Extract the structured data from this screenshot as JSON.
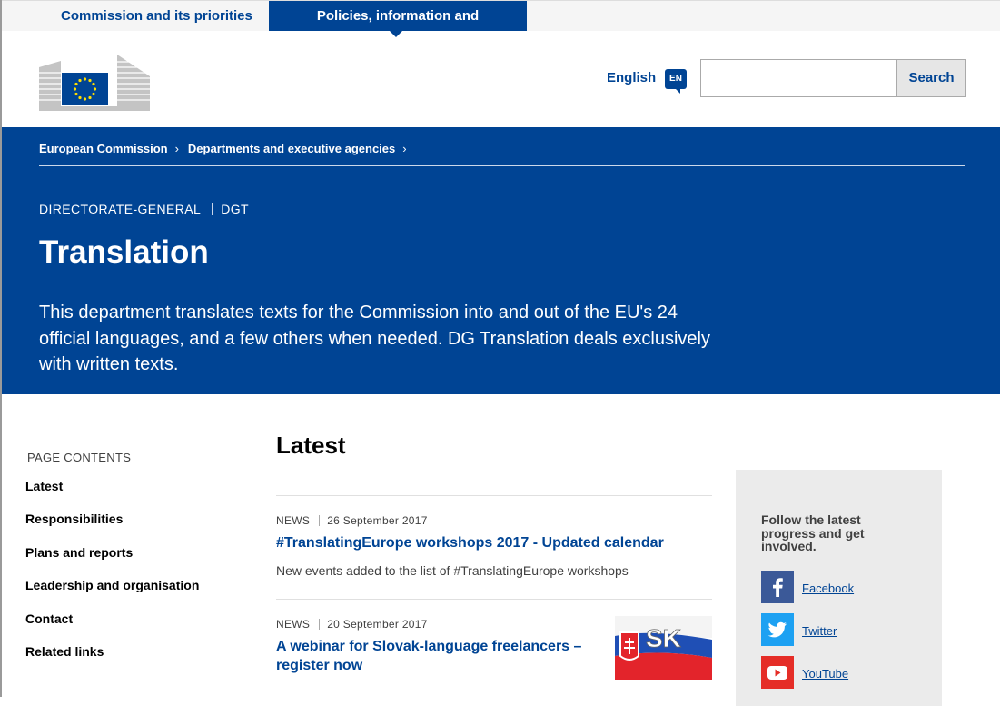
{
  "topnav": {
    "tab1": "Commission and its priorities",
    "tab2": "Policies, information and services"
  },
  "header": {
    "language": "English",
    "language_code": "EN",
    "search_button": "Search",
    "search_placeholder": ""
  },
  "breadcrumb": [
    "European Commission",
    "Departments and executive agencies"
  ],
  "banner": {
    "meta_type": "DIRECTORATE-GENERAL",
    "meta_acronym": "DGT",
    "title": "Translation",
    "description": "This department translates texts for the Commission into and out of the EU's 24 official languages, and a few others when needed. DG Translation deals exclusively with written texts."
  },
  "page_contents": {
    "label": "PAGE CONTENTS",
    "items": [
      "Latest",
      "Responsibilities",
      "Plans and reports",
      "Leadership and organisation",
      "Contact",
      "Related links"
    ]
  },
  "latest": {
    "heading": "Latest",
    "news": [
      {
        "type": "NEWS",
        "date": "26 September 2017",
        "title": "#TranslatingEurope workshops 2017 - Updated calendar",
        "description": "New events added to the list of #TranslatingEurope workshops"
      },
      {
        "type": "NEWS",
        "date": "20 September 2017",
        "title_line1": "A webinar for Slovak-language freelancers –",
        "title_line2": "register now",
        "thumb_text": "SK"
      }
    ]
  },
  "follow": {
    "text": "Follow the latest progress and get involved.",
    "links": [
      {
        "label": "Facebook",
        "icon": "facebook-icon",
        "color": "#3b5998"
      },
      {
        "label": "Twitter",
        "icon": "twitter-icon",
        "color": "#1da1f2"
      },
      {
        "label": "YouTube",
        "icon": "youtube-icon",
        "color": "#e52d27"
      }
    ]
  },
  "colors": {
    "brand_blue": "#004494",
    "eu_yellow": "#ffde00"
  }
}
